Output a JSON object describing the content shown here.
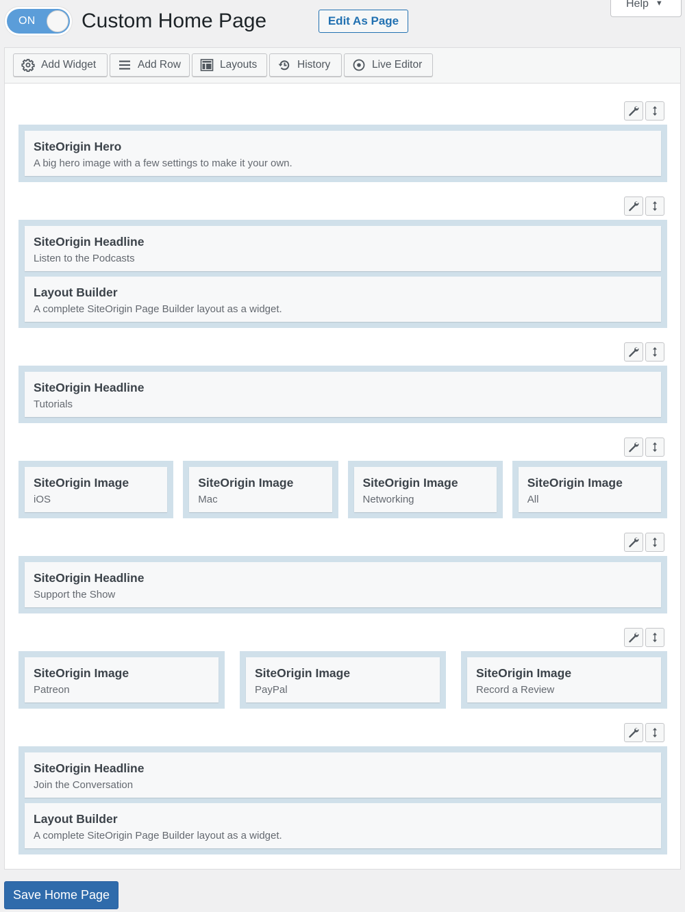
{
  "header": {
    "toggle_label": "ON",
    "toggle_state": "on",
    "title": "Custom Home Page",
    "edit_as_page_label": "Edit As Page",
    "help_label": "Help"
  },
  "toolbar": {
    "buttons": [
      {
        "label": "Add Widget",
        "icon": "gear-icon"
      },
      {
        "label": "Add Row",
        "icon": "menu-lines-icon"
      },
      {
        "label": "Layouts",
        "icon": "layout-icon"
      },
      {
        "label": "History",
        "icon": "history-icon"
      },
      {
        "label": "Live Editor",
        "icon": "eye-icon"
      }
    ]
  },
  "rows": [
    {
      "cells": [
        [
          {
            "title": "SiteOrigin Hero",
            "desc": "A big hero image with a few settings to make it your own."
          }
        ]
      ]
    },
    {
      "cells": [
        [
          {
            "title": "SiteOrigin Headline",
            "desc": "Listen to the Podcasts"
          },
          {
            "title": "Layout Builder",
            "desc": "A complete SiteOrigin Page Builder layout as a widget."
          }
        ]
      ]
    },
    {
      "cells": [
        [
          {
            "title": "SiteOrigin Headline",
            "desc": "Tutorials"
          }
        ]
      ]
    },
    {
      "cells": [
        [
          {
            "title": "SiteOrigin Image",
            "desc": "iOS"
          }
        ],
        [
          {
            "title": "SiteOrigin Image",
            "desc": "Mac"
          }
        ],
        [
          {
            "title": "SiteOrigin Image",
            "desc": "Networking"
          }
        ],
        [
          {
            "title": "SiteOrigin Image",
            "desc": "All"
          }
        ]
      ]
    },
    {
      "cells": [
        [
          {
            "title": "SiteOrigin Headline",
            "desc": "Support the Show"
          }
        ]
      ]
    },
    {
      "cells": [
        [
          {
            "title": "SiteOrigin Image",
            "desc": "Patreon"
          }
        ],
        [
          {
            "title": "SiteOrigin Image",
            "desc": "PayPal"
          }
        ],
        [
          {
            "title": "SiteOrigin Image",
            "desc": "Record a Review"
          }
        ]
      ]
    },
    {
      "cells": [
        [
          {
            "title": "SiteOrigin Headline",
            "desc": "Join the Conversation"
          },
          {
            "title": "Layout Builder",
            "desc": "A complete SiteOrigin Page Builder layout as a widget."
          }
        ]
      ]
    }
  ],
  "row_tools": {
    "edit_icon": "wrench-icon",
    "move_icon": "move-vertical-icon"
  },
  "footer": {
    "save_label": "Save Home Page"
  },
  "colors": {
    "accent": "#2271b1",
    "save_button": "#2f6bab",
    "toggle_on": "#5b9dd9",
    "cell_bg": "#d0e0ea",
    "widget_bg": "#f7f8f9"
  }
}
